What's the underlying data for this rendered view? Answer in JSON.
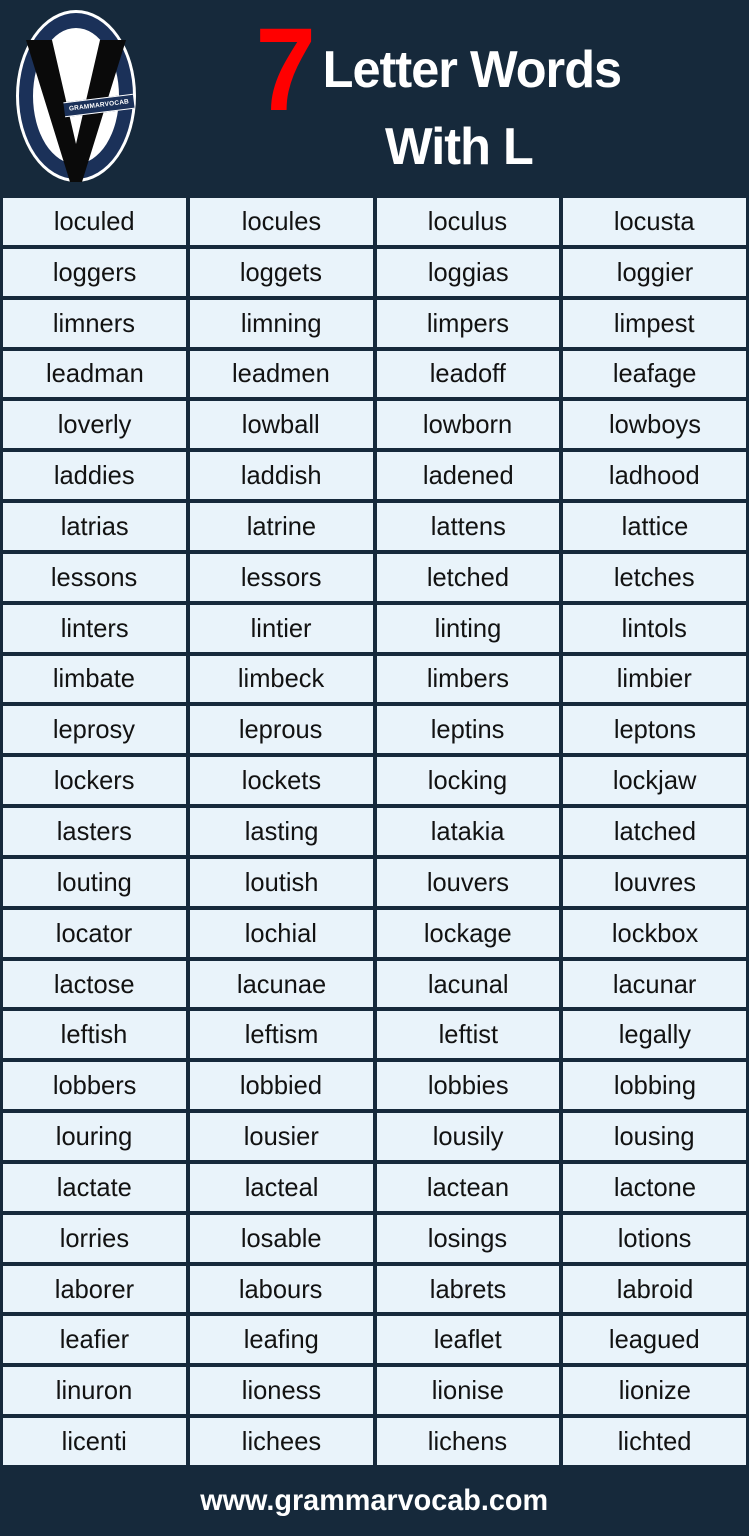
{
  "header": {
    "logo": {
      "icon": "grammarvocab-logo-icon",
      "banner_text": "GRAMMARVOCAB",
      "navy": "#1b3159",
      "white": "#ffffff"
    },
    "number": "7",
    "number_color": "#ff0000",
    "title_line1": "Letter Words",
    "title_line2": "With L",
    "background": "#16293b",
    "title_color": "#ffffff"
  },
  "grid": {
    "columns": 4,
    "rows": 25,
    "cell_background": "#e9f3fa",
    "cell_text_color": "#121212",
    "words": [
      "loculed",
      "locules",
      "loculus",
      "locusta",
      "loggers",
      "loggets",
      "loggias",
      "loggier",
      "limners",
      "limning",
      "limpers",
      "limpest",
      "leadman",
      "leadmen",
      "leadoff",
      "leafage",
      "loverly",
      "lowball",
      "lowborn",
      "lowboys",
      "laddies",
      "laddish",
      "ladened",
      "ladhood",
      "latrias",
      "latrine",
      "lattens",
      "lattice",
      "lessons",
      "lessors",
      "letched",
      "letches",
      "linters",
      "lintier",
      "linting",
      "lintols",
      "limbate",
      "limbeck",
      "limbers",
      "limbier",
      "leprosy",
      "leprous",
      "leptins",
      "leptons",
      "lockers",
      "lockets",
      "locking",
      "lockjaw",
      "lasters",
      "lasting",
      "latakia",
      "latched",
      "louting",
      "loutish",
      "louvers",
      "louvres",
      "locator",
      "lochial",
      "lockage",
      "lockbox",
      "lactose",
      "lacunae",
      "lacunal",
      "lacunar",
      "leftish",
      "leftism",
      "leftist",
      "legally",
      "lobbers",
      "lobbied",
      "lobbies",
      "lobbing",
      "louring",
      "lousier",
      "lousily",
      "lousing",
      "lactate",
      "lacteal",
      "lactean",
      "lactone",
      "lorries",
      "losable",
      "losings",
      "lotions",
      "laborer",
      "labours",
      "labrets",
      "labroid",
      "leafier",
      "leafing",
      "leaflet",
      "leagued",
      "linuron",
      "lioness",
      "lionise",
      "lionize",
      "licenti",
      "lichees",
      "lichens",
      "lichted"
    ]
  },
  "footer": {
    "website": "www.grammarvocab.com",
    "background": "#16293b",
    "text_color": "#ffffff"
  }
}
